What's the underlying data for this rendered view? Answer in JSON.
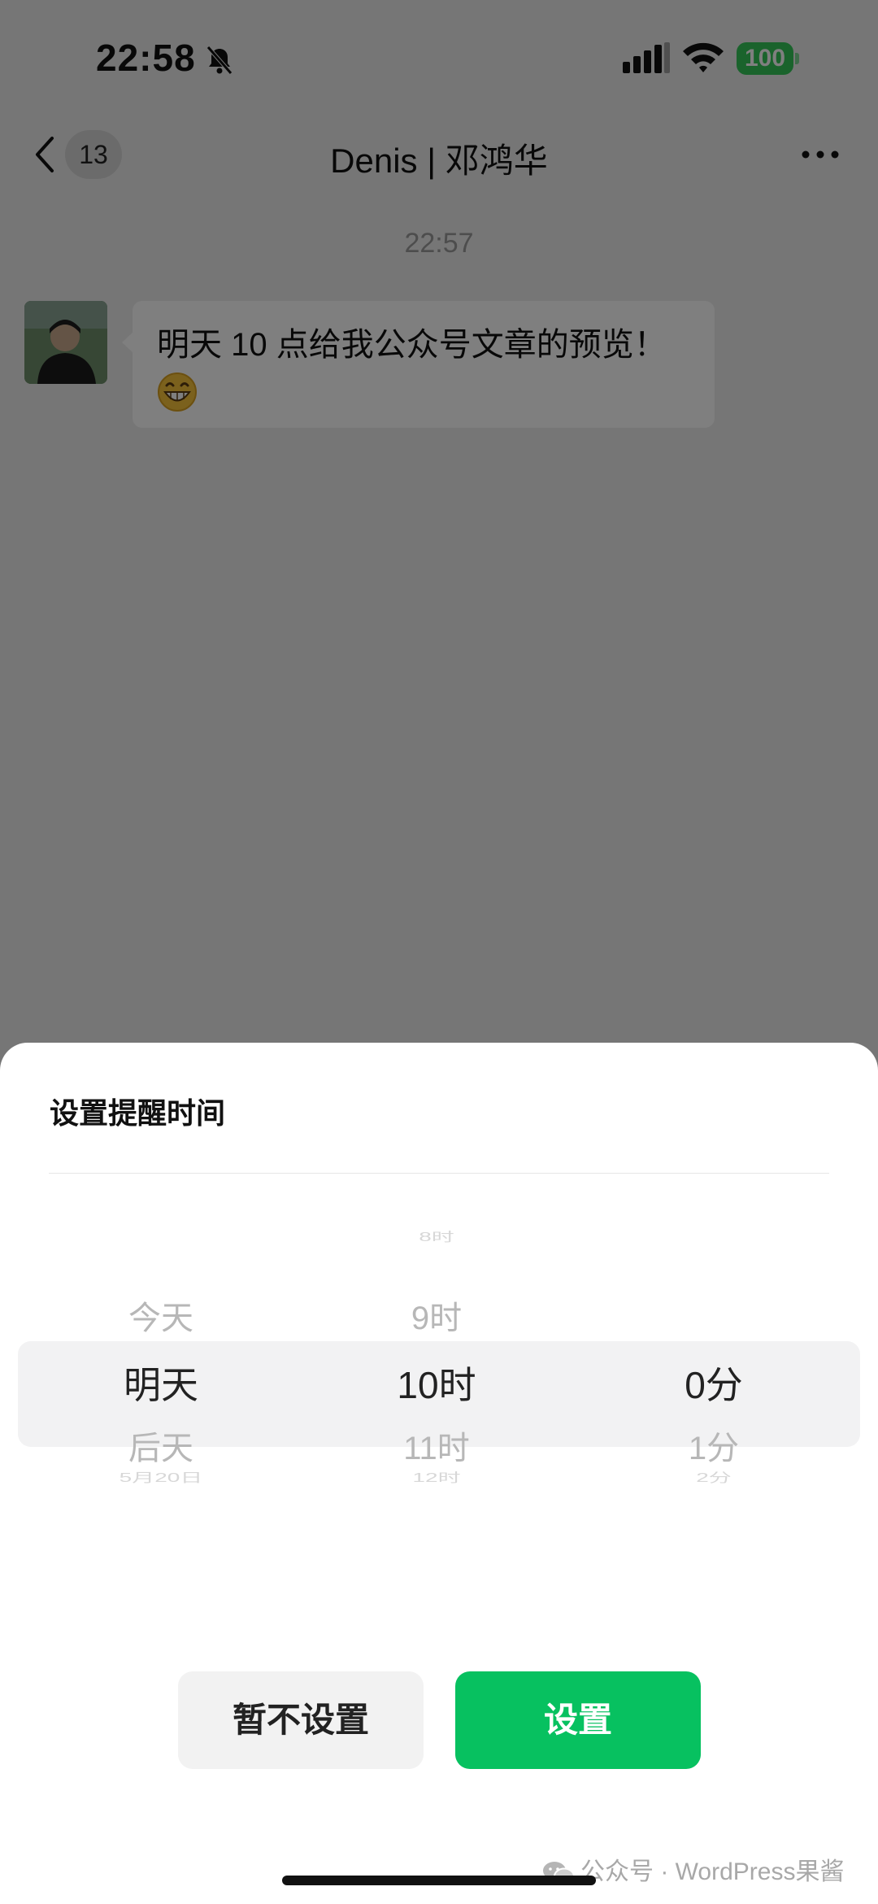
{
  "status_bar": {
    "time": "22:58",
    "battery": "100",
    "icons": [
      "bell-slash-icon",
      "signal-icon",
      "wifi-icon",
      "battery-icon"
    ]
  },
  "nav": {
    "unread_count": "13",
    "title": "Denis | 邓鸿华",
    "icons": [
      "chevron-left-icon",
      "more-icon"
    ]
  },
  "chat": {
    "timestamp": "22:57",
    "message": "明天 10 点给我公众号文章的预览！",
    "emoji": "grinning-face-icon"
  },
  "reminder_sheet": {
    "title": "设置提醒时间",
    "day_column": {
      "items": [
        "今天",
        "明天",
        "后天",
        "5月20日"
      ],
      "selected": "明天"
    },
    "hour_column": {
      "items": [
        "8时",
        "9时",
        "10时",
        "11时",
        "12时"
      ],
      "selected": "10时"
    },
    "minute_column": {
      "items": [
        "0分",
        "1分",
        "2分"
      ],
      "selected": "0分"
    },
    "cancel_label": "暂不设置",
    "confirm_label": "设置"
  },
  "watermark": "公众号 · WordPress果酱",
  "colors": {
    "accent": "#07c160",
    "battery": "#34c759",
    "overlay": "rgba(0,0,0,0.5)"
  }
}
